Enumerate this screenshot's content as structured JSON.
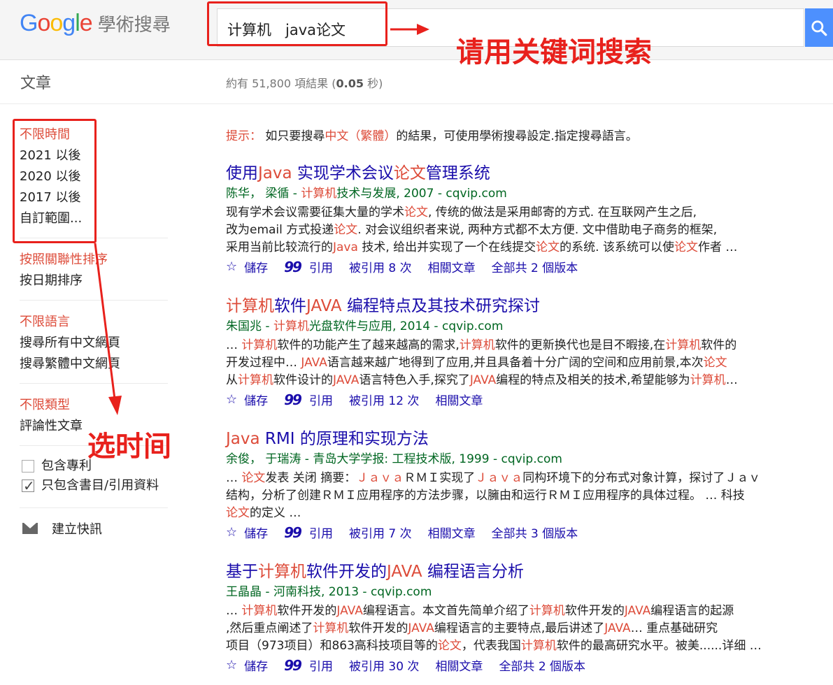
{
  "header": {
    "logo_google": "Google",
    "logo_scholar": "學術搜尋",
    "search_query": "计算机   java论文",
    "annotation_search": "请用关键词搜索"
  },
  "subheader": {
    "section_title": "文章",
    "stats_prefix": "約有 51,800 項結果 (",
    "stats_time": "0.05",
    "stats_suffix": " 秒)"
  },
  "sidebar": {
    "time_filters": [
      "不限時間",
      "2021 以後",
      "2020 以後",
      "2017 以後",
      "自訂範圍..."
    ],
    "sort_options": [
      "按照關聯性排序",
      "按日期排序"
    ],
    "language_options": [
      "不限語言",
      "搜尋所有中文網頁",
      "搜尋繁體中文網頁"
    ],
    "type_options": [
      "不限類型",
      "評論性文章"
    ],
    "include_patents": "包含專利",
    "include_citations": "只包含書目/引用資料",
    "create_alert": "建立快訊",
    "annotation_time": "选时间"
  },
  "tip": {
    "label": "提示：",
    "text_a": " 如只要搜尋",
    "text_red": "中文（繁體）",
    "text_b": "的結果，可使用學術搜尋設定.指定搜尋語言。"
  },
  "results": [
    {
      "title": "使用Java 实现学术会议论文管理系统",
      "meta": "陈华， 梁循 - 计算机技术与发展, 2007 - cqvip.com",
      "snippet": [
        "现有学术会议需要征集大量的学术论文, 传统的做法是采用邮寄的方式. 在互联网产生之后,",
        "改为email 方式投递论文. 对会议组织者来说, 两种方式都不太方便. 文中借助电子商务的框架,",
        "采用当前比较流行的Java 技术, 给出并实现了一个在线提交论文的系统. 该系统可以使论文作者 …"
      ],
      "save": "儲存",
      "cite": "引用",
      "cited_by": "被引用 8 次",
      "related": "相關文章",
      "versions": "全部共 2 個版本"
    },
    {
      "title": "计算机软件JAVA 编程特点及其技术研究探讨",
      "meta": "朱国兆 - 计算机光盘软件与应用, 2014 - cqvip.com",
      "snippet": [
        "… 计算机软件的功能产生了越来越高的需求,计算机软件的更新换代也是目不暇接,在计算机软件的",
        "开发过程中… JAVA语言越来越广地得到了应用,并且具备着十分广阔的空间和应用前景,本次论文",
        "从计算机软件设计的JAVA语言特色入手,探究了JAVA编程的特点及相关的技术,希望能够为计算机…"
      ],
      "save": "儲存",
      "cite": "引用",
      "cited_by": "被引用 12 次",
      "related": "相關文章",
      "versions": ""
    },
    {
      "title": "Java RMI 的原理和实现方法",
      "meta": "余俊， 于瑞涛 - 青岛大学学报: 工程技术版, 1999 - cqvip.com",
      "snippet": [
        "… 论文发表 关闭 摘要：ＪａｖａＲＭＩ实现了Ｊａｖａ同构环境下的分布式对象计算，探讨了Ｊａｖ",
        "结构，分析了创建ＲＭＩ应用程序的方法步骤，以臃由和运行ＲＭＩ应用程序的具体过程。 … 科技",
        "论文的定义 …"
      ],
      "save": "儲存",
      "cite": "引用",
      "cited_by": "被引用 7 次",
      "related": "相關文章",
      "versions": "全部共 3 個版本"
    },
    {
      "title": "基于计算机软件开发的JAVA 编程语言分析",
      "meta": "王晶晶 - 河南科技, 2013 - cqvip.com",
      "snippet": [
        "… 计算机软件开发的JAVA编程语言。本文首先简单介绍了计算机软件开发的JAVA编程语言的起源",
        ",然后重点阐述了计算机软件开发的JAVA编程语言的主要特点,最后讲述了JAVA… 重点基础研究",
        "项目（973项目）和863高科技项目等的论文，代表我国计算机软件的最高研究水平。被美......详细 …"
      ],
      "save": "儲存",
      "cite": "引用",
      "cited_by": "被引用 30 次",
      "related": "相關文章",
      "versions": "全部共 2 個版本"
    }
  ],
  "highlight_terms": [
    "计算机",
    "论文",
    "Java",
    "JAVA",
    "Ｊａｖａ"
  ]
}
